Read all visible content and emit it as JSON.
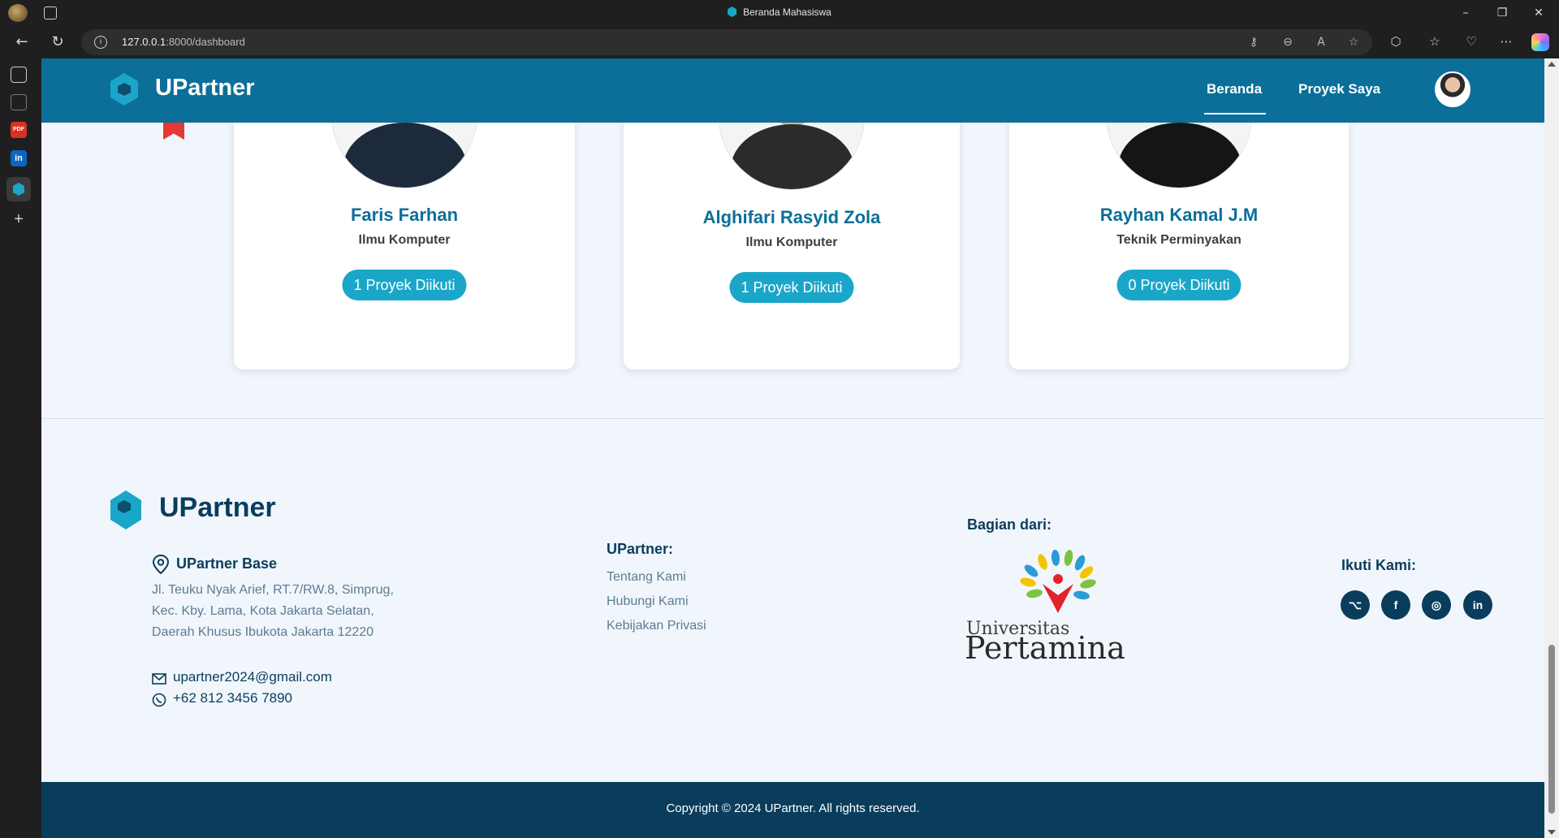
{
  "browser": {
    "window_title": "Beranda Mahasiswa",
    "url_host": "127.0.0.1",
    "url_path": ":8000/dashboard"
  },
  "site": {
    "brand": "UPartner",
    "nav": {
      "home": "Beranda",
      "projects": "Proyek Saya"
    }
  },
  "team": [
    {
      "name": "Faris Farhan",
      "major": "Ilmu Komputer",
      "projects": "1 Proyek Diikuti"
    },
    {
      "name": "Alghifari Rasyid Zola",
      "major": "Ilmu Komputer",
      "projects": "1 Proyek Diikuti"
    },
    {
      "name": "Rayhan Kamal J.M",
      "major": "Teknik Perminyakan",
      "projects": "0 Proyek Diikuti"
    }
  ],
  "footer": {
    "brand": "UPartner",
    "base_title": "UPartner Base",
    "address": [
      "Jl. Teuku Nyak Arief, RT.7/RW.8, Simprug,",
      "Kec. Kby. Lama, Kota Jakarta Selatan,",
      "Daerah Khusus Ibukota Jakarta 12220"
    ],
    "email": "upartner2024@gmail.com",
    "phone": "+62 812 3456 7890",
    "links_title": "UPartner:",
    "links": [
      "Tentang Kami",
      "Hubungi Kami",
      "Kebijakan Privasi"
    ],
    "part_of_title": "Bagian dari:",
    "university_line1": "Universitas",
    "university_line2": "Pertamina",
    "follow_title": "Ikuti Kami:",
    "socials": [
      "github-icon",
      "facebook-icon",
      "instagram-icon",
      "linkedin-icon"
    ],
    "copyright": "Copyright © 2024 UPartner. All rights reserved."
  },
  "colors": {
    "header": "#0b6f99",
    "accent": "#1aa6c9",
    "footer_dark": "#0a3d5c",
    "page_bg": "#f1f6fc"
  }
}
